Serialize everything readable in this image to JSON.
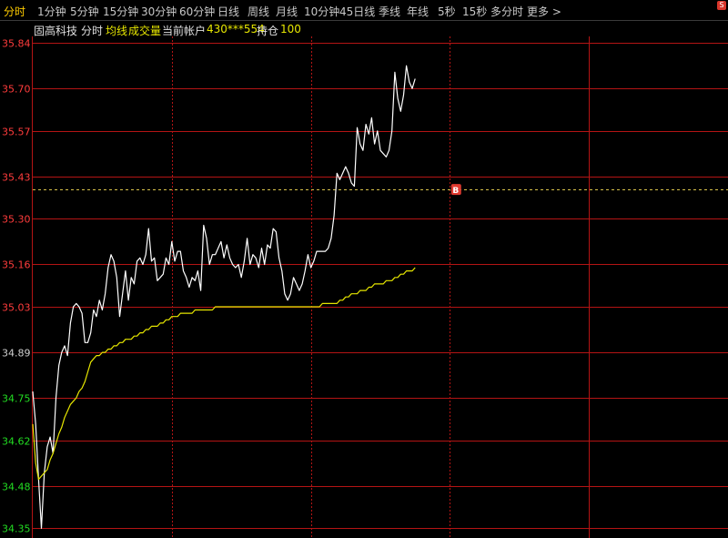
{
  "tabs": [
    {
      "label": "分时",
      "active": true
    },
    {
      "label": "1分钟"
    },
    {
      "label": "5分钟"
    },
    {
      "label": "15分钟"
    },
    {
      "label": "30分钟"
    },
    {
      "label": "60分钟"
    },
    {
      "label": "日线"
    },
    {
      "label": "周线"
    },
    {
      "label": "月线"
    },
    {
      "label": "10分钟"
    },
    {
      "label": "45日线"
    },
    {
      "label": "季线"
    },
    {
      "label": "年线"
    },
    {
      "label": "5秒"
    },
    {
      "label": "15秒"
    },
    {
      "label": "多分时"
    },
    {
      "label": "更多 >"
    }
  ],
  "corner_badge": "S",
  "info": {
    "stock_name": "固高科技",
    "mode": "分时",
    "avg_line": "均线",
    "volume": "成交量",
    "account_label": "当前帐户",
    "account_value": "430***554",
    "position_label": "持仓",
    "position_value": "100"
  },
  "colors": {
    "price_line": "#ffffff",
    "avg_line": "#e6e600",
    "grid": "#b41414",
    "up_label": "#ff3c3c",
    "down_label": "#22dd22",
    "reference_line": "#d8c24a",
    "marker": "#e03a30"
  },
  "chart_data": {
    "type": "line",
    "y_ticks_up": [
      "35.84",
      "35.70",
      "35.57",
      "35.43",
      "35.30",
      "35.16",
      "35.03"
    ],
    "y_tick_mid": "34.89",
    "y_ticks_down": [
      "34.75",
      "34.62",
      "34.48",
      "34.35"
    ],
    "ylim": [
      34.32,
      35.86
    ],
    "x_range": [
      0,
      240
    ],
    "reference_price": 35.39,
    "marker": {
      "label": "B",
      "x": 146,
      "y": 35.39
    },
    "series": [
      {
        "key": "price",
        "points": [
          [
            0,
            34.77
          ],
          [
            1,
            34.67
          ],
          [
            2,
            34.5
          ],
          [
            3,
            34.35
          ],
          [
            4,
            34.52
          ],
          [
            5,
            34.6
          ],
          [
            6,
            34.63
          ],
          [
            7,
            34.58
          ],
          [
            8,
            34.75
          ],
          [
            9,
            34.85
          ],
          [
            10,
            34.89
          ],
          [
            11,
            34.91
          ],
          [
            12,
            34.88
          ],
          [
            13,
            34.98
          ],
          [
            14,
            35.03
          ],
          [
            15,
            35.04
          ],
          [
            16,
            35.03
          ],
          [
            17,
            35.01
          ],
          [
            18,
            34.92
          ],
          [
            19,
            34.92
          ],
          [
            20,
            34.95
          ],
          [
            21,
            35.02
          ],
          [
            22,
            35.0
          ],
          [
            23,
            35.05
          ],
          [
            24,
            35.02
          ],
          [
            25,
            35.07
          ],
          [
            26,
            35.15
          ],
          [
            27,
            35.19
          ],
          [
            28,
            35.17
          ],
          [
            29,
            35.12
          ],
          [
            30,
            35.0
          ],
          [
            31,
            35.07
          ],
          [
            32,
            35.14
          ],
          [
            33,
            35.05
          ],
          [
            34,
            35.12
          ],
          [
            35,
            35.1
          ],
          [
            36,
            35.17
          ],
          [
            37,
            35.18
          ],
          [
            38,
            35.16
          ],
          [
            39,
            35.19
          ],
          [
            40,
            35.27
          ],
          [
            41,
            35.17
          ],
          [
            42,
            35.18
          ],
          [
            43,
            35.11
          ],
          [
            44,
            35.12
          ],
          [
            45,
            35.13
          ],
          [
            46,
            35.18
          ],
          [
            47,
            35.16
          ],
          [
            48,
            35.23
          ],
          [
            49,
            35.17
          ],
          [
            50,
            35.2
          ],
          [
            51,
            35.2
          ],
          [
            52,
            35.14
          ],
          [
            53,
            35.12
          ],
          [
            54,
            35.09
          ],
          [
            55,
            35.12
          ],
          [
            56,
            35.11
          ],
          [
            57,
            35.14
          ],
          [
            58,
            35.08
          ],
          [
            59,
            35.28
          ],
          [
            60,
            35.24
          ],
          [
            61,
            35.16
          ],
          [
            62,
            35.19
          ],
          [
            63,
            35.19
          ],
          [
            64,
            35.21
          ],
          [
            65,
            35.23
          ],
          [
            66,
            35.18
          ],
          [
            67,
            35.22
          ],
          [
            68,
            35.18
          ],
          [
            69,
            35.16
          ],
          [
            70,
            35.15
          ],
          [
            71,
            35.16
          ],
          [
            72,
            35.12
          ],
          [
            73,
            35.17
          ],
          [
            74,
            35.24
          ],
          [
            75,
            35.16
          ],
          [
            76,
            35.19
          ],
          [
            77,
            35.18
          ],
          [
            78,
            35.15
          ],
          [
            79,
            35.21
          ],
          [
            80,
            35.16
          ],
          [
            81,
            35.22
          ],
          [
            82,
            35.21
          ],
          [
            83,
            35.27
          ],
          [
            84,
            35.26
          ],
          [
            85,
            35.18
          ],
          [
            86,
            35.14
          ],
          [
            87,
            35.07
          ],
          [
            88,
            35.05
          ],
          [
            89,
            35.07
          ],
          [
            90,
            35.12
          ],
          [
            91,
            35.1
          ],
          [
            92,
            35.08
          ],
          [
            93,
            35.1
          ],
          [
            94,
            35.14
          ],
          [
            95,
            35.19
          ],
          [
            96,
            35.15
          ],
          [
            97,
            35.17
          ],
          [
            98,
            35.2
          ],
          [
            99,
            35.2
          ],
          [
            100,
            35.2
          ],
          [
            101,
            35.2
          ],
          [
            102,
            35.21
          ],
          [
            103,
            35.24
          ],
          [
            104,
            35.31
          ],
          [
            105,
            35.44
          ],
          [
            106,
            35.42
          ],
          [
            107,
            35.44
          ],
          [
            108,
            35.46
          ],
          [
            109,
            35.44
          ],
          [
            110,
            35.41
          ],
          [
            111,
            35.4
          ],
          [
            112,
            35.58
          ],
          [
            113,
            35.53
          ],
          [
            114,
            35.51
          ],
          [
            115,
            35.59
          ],
          [
            116,
            35.56
          ],
          [
            117,
            35.61
          ],
          [
            118,
            35.53
          ],
          [
            119,
            35.57
          ],
          [
            120,
            35.51
          ],
          [
            121,
            35.5
          ],
          [
            122,
            35.49
          ],
          [
            123,
            35.51
          ],
          [
            124,
            35.57
          ],
          [
            125,
            35.75
          ],
          [
            126,
            35.67
          ],
          [
            127,
            35.63
          ],
          [
            128,
            35.68
          ],
          [
            129,
            35.77
          ],
          [
            130,
            35.72
          ],
          [
            131,
            35.7
          ],
          [
            132,
            35.73
          ]
        ]
      },
      {
        "key": "avg",
        "points": [
          [
            0,
            34.67
          ],
          [
            1,
            34.55
          ],
          [
            2,
            34.5
          ],
          [
            3,
            34.51
          ],
          [
            4,
            34.52
          ],
          [
            5,
            34.53
          ],
          [
            6,
            34.56
          ],
          [
            7,
            34.58
          ],
          [
            8,
            34.61
          ],
          [
            9,
            34.64
          ],
          [
            10,
            34.66
          ],
          [
            11,
            34.69
          ],
          [
            12,
            34.71
          ],
          [
            13,
            34.73
          ],
          [
            14,
            34.74
          ],
          [
            15,
            34.75
          ],
          [
            16,
            34.77
          ],
          [
            17,
            34.78
          ],
          [
            18,
            34.8
          ],
          [
            19,
            34.83
          ],
          [
            20,
            34.86
          ],
          [
            21,
            34.87
          ],
          [
            22,
            34.88
          ],
          [
            23,
            34.88
          ],
          [
            24,
            34.89
          ],
          [
            25,
            34.89
          ],
          [
            26,
            34.9
          ],
          [
            27,
            34.9
          ],
          [
            28,
            34.91
          ],
          [
            29,
            34.91
          ],
          [
            30,
            34.92
          ],
          [
            31,
            34.92
          ],
          [
            32,
            34.93
          ],
          [
            33,
            34.93
          ],
          [
            34,
            34.93
          ],
          [
            35,
            34.94
          ],
          [
            36,
            34.94
          ],
          [
            37,
            34.95
          ],
          [
            38,
            34.95
          ],
          [
            39,
            34.96
          ],
          [
            40,
            34.96
          ],
          [
            41,
            34.97
          ],
          [
            42,
            34.97
          ],
          [
            43,
            34.97
          ],
          [
            44,
            34.98
          ],
          [
            45,
            34.98
          ],
          [
            46,
            34.99
          ],
          [
            47,
            34.99
          ],
          [
            48,
            35.0
          ],
          [
            49,
            35.0
          ],
          [
            50,
            35.0
          ],
          [
            51,
            35.01
          ],
          [
            52,
            35.01
          ],
          [
            53,
            35.01
          ],
          [
            54,
            35.01
          ],
          [
            55,
            35.01
          ],
          [
            56,
            35.02
          ],
          [
            57,
            35.02
          ],
          [
            58,
            35.02
          ],
          [
            59,
            35.02
          ],
          [
            60,
            35.02
          ],
          [
            61,
            35.02
          ],
          [
            62,
            35.02
          ],
          [
            63,
            35.03
          ],
          [
            64,
            35.03
          ],
          [
            65,
            35.03
          ],
          [
            66,
            35.03
          ],
          [
            67,
            35.03
          ],
          [
            68,
            35.03
          ],
          [
            69,
            35.03
          ],
          [
            70,
            35.03
          ],
          [
            71,
            35.03
          ],
          [
            72,
            35.03
          ],
          [
            73,
            35.03
          ],
          [
            74,
            35.03
          ],
          [
            75,
            35.03
          ],
          [
            76,
            35.03
          ],
          [
            77,
            35.03
          ],
          [
            78,
            35.03
          ],
          [
            79,
            35.03
          ],
          [
            80,
            35.03
          ],
          [
            81,
            35.03
          ],
          [
            82,
            35.03
          ],
          [
            83,
            35.03
          ],
          [
            84,
            35.03
          ],
          [
            85,
            35.03
          ],
          [
            86,
            35.03
          ],
          [
            87,
            35.03
          ],
          [
            88,
            35.03
          ],
          [
            89,
            35.03
          ],
          [
            90,
            35.03
          ],
          [
            91,
            35.03
          ],
          [
            92,
            35.03
          ],
          [
            93,
            35.03
          ],
          [
            94,
            35.03
          ],
          [
            95,
            35.03
          ],
          [
            96,
            35.03
          ],
          [
            97,
            35.03
          ],
          [
            98,
            35.03
          ],
          [
            99,
            35.03
          ],
          [
            100,
            35.04
          ],
          [
            101,
            35.04
          ],
          [
            102,
            35.04
          ],
          [
            103,
            35.04
          ],
          [
            104,
            35.04
          ],
          [
            105,
            35.04
          ],
          [
            106,
            35.05
          ],
          [
            107,
            35.05
          ],
          [
            108,
            35.06
          ],
          [
            109,
            35.06
          ],
          [
            110,
            35.07
          ],
          [
            111,
            35.07
          ],
          [
            112,
            35.07
          ],
          [
            113,
            35.08
          ],
          [
            114,
            35.08
          ],
          [
            115,
            35.08
          ],
          [
            116,
            35.09
          ],
          [
            117,
            35.09
          ],
          [
            118,
            35.1
          ],
          [
            119,
            35.1
          ],
          [
            120,
            35.1
          ],
          [
            121,
            35.1
          ],
          [
            122,
            35.11
          ],
          [
            123,
            35.11
          ],
          [
            124,
            35.11
          ],
          [
            125,
            35.12
          ],
          [
            126,
            35.12
          ],
          [
            127,
            35.13
          ],
          [
            128,
            35.13
          ],
          [
            129,
            35.14
          ],
          [
            130,
            35.14
          ],
          [
            131,
            35.14
          ],
          [
            132,
            35.15
          ]
        ]
      }
    ]
  }
}
